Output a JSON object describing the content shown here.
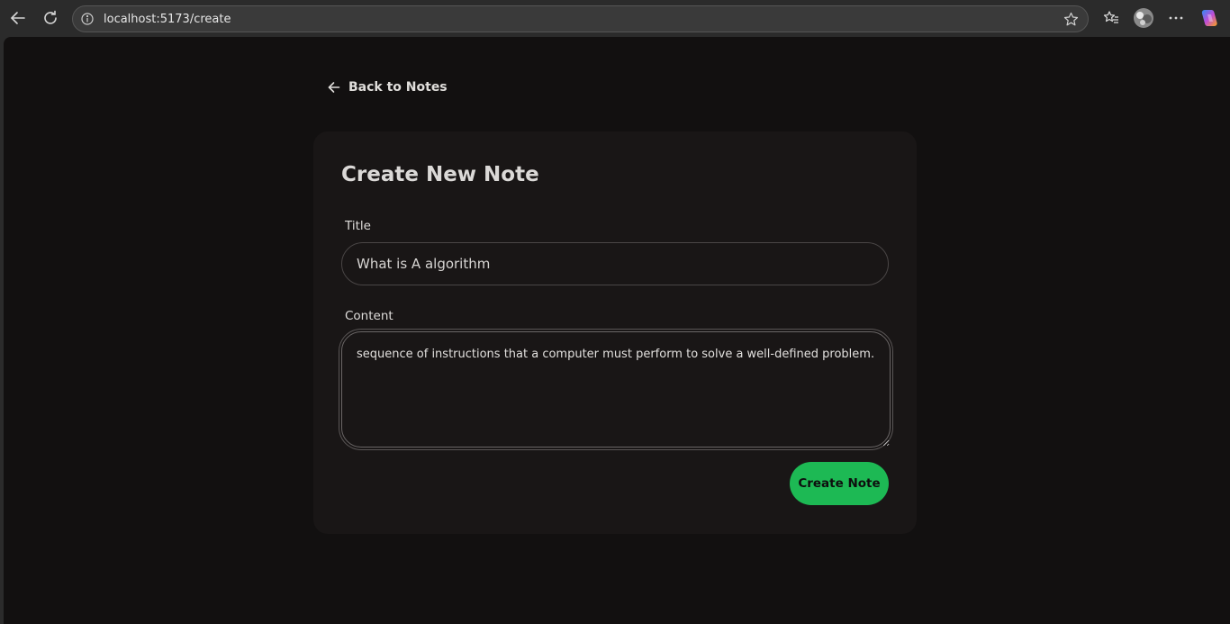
{
  "browser": {
    "url": "localhost:5173/create"
  },
  "page": {
    "back_label": "Back to Notes",
    "heading": "Create New Note",
    "title_label": "Title",
    "title_value": "What is A algorithm",
    "content_label": "Content",
    "content_value": "sequence of instructions that a computer must perform to solve a well-defined problem.",
    "submit_label": "Create Note"
  },
  "colors": {
    "accent": "#1db954",
    "background": "#121010",
    "card": "#191616"
  }
}
